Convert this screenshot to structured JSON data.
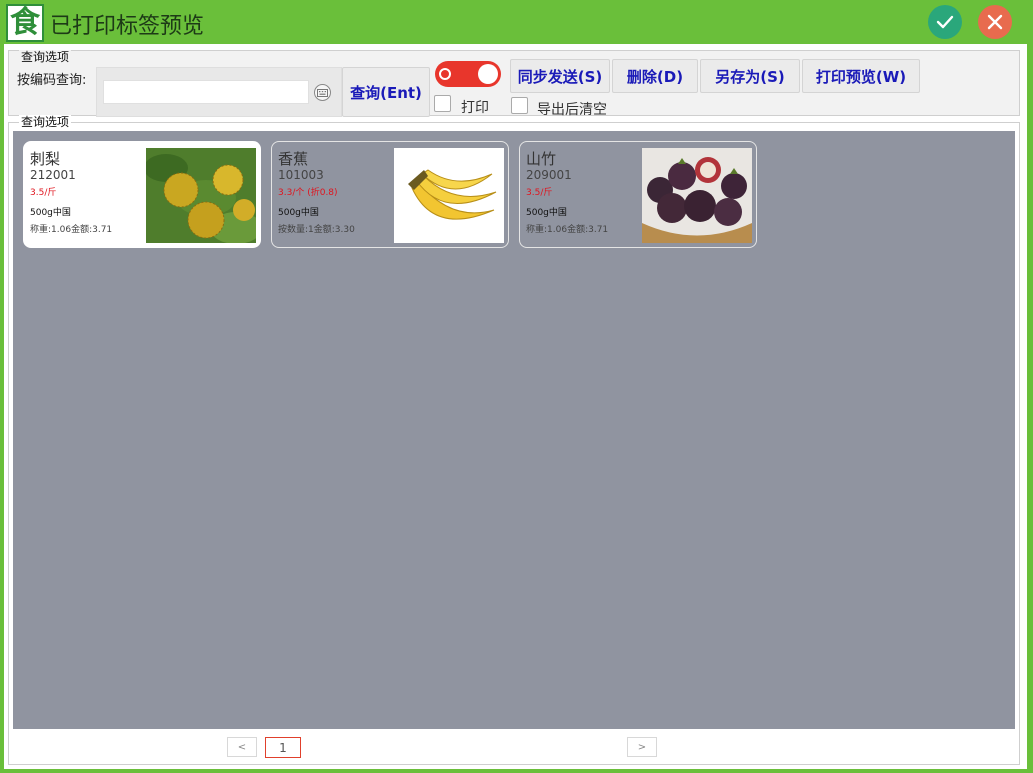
{
  "window": {
    "title": "已打印标签预览",
    "logo_text": "食"
  },
  "query": {
    "legend": "查询选项",
    "search_label": "按编码查询:",
    "search_value": "",
    "search_placeholder": "",
    "query_button": "查询(Ent)",
    "toggle_on": false
  },
  "toolbar": {
    "sync_label": "同步发送(S)",
    "delete_label": "删除(D)",
    "save_as_label": "另存为(S)",
    "print_preview_label": "打印预览(W)",
    "print_checkbox_label": "打印",
    "print_checked": false,
    "clear_after_export_label": "导出后清空",
    "clear_checked": false
  },
  "results": {
    "legend": "查询选项",
    "cards": [
      {
        "name": "刺梨",
        "code": "212001",
        "price": "3.5/斤",
        "spec": "500g中国",
        "detail": "称重:1.06金额:3.71",
        "selected": true,
        "image": "prickly-pear-image"
      },
      {
        "name": "香蕉",
        "code": "101003",
        "price": "3.3/个 (折0.8)",
        "spec": "500g中国",
        "detail": "按数量:1金额:3.30",
        "selected": false,
        "image": "banana-image"
      },
      {
        "name": "山竹",
        "code": "209001",
        "price": "3.5/斤",
        "spec": "500g中国",
        "detail": "称重:1.06金额:3.71",
        "selected": false,
        "image": "mangosteen-image"
      }
    ]
  },
  "pager": {
    "prev": "<",
    "current_page": "1",
    "next": ">"
  },
  "colors": {
    "title_bar": "#6abf3a",
    "ok_button": "#2aa77b",
    "close_button": "#e86b4e",
    "toggle": "#e8362c",
    "button_text": "#1a1ab8",
    "grid_background": "#9094a0",
    "price_text": "#e0141e"
  }
}
